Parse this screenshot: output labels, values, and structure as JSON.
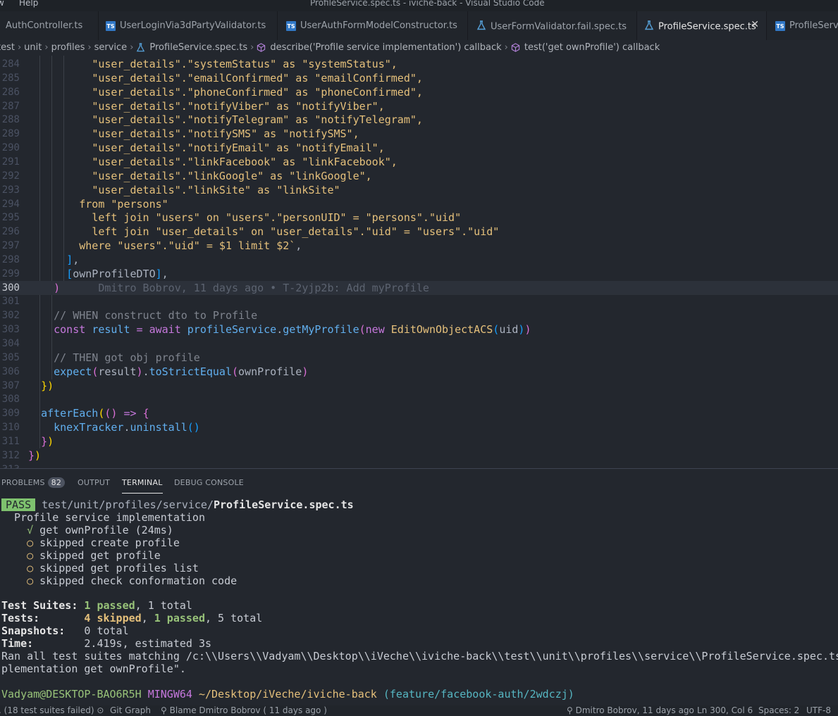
{
  "titlebar": {
    "menu_view": "w",
    "menu_help": "Help",
    "title": "ProfileService.spec.ts - iviche-back - Visual Studio Code"
  },
  "tabs": [
    {
      "label": "AuthController.ts",
      "type": "plain"
    },
    {
      "label": "UserLoginVia3dPartyValidator.ts",
      "type": "ts"
    },
    {
      "label": "UserAuthFormModelConstructor.ts",
      "type": "ts"
    },
    {
      "label": "UserFormValidator.fail.spec.ts",
      "type": "test"
    },
    {
      "label": "ProfileService.spec.ts",
      "type": "test",
      "active": true
    },
    {
      "label": "ProfileServ",
      "type": "ts"
    }
  ],
  "breadcrumb": {
    "items": [
      "test",
      "unit",
      "profiles",
      "service",
      "ProfileService.spec.ts",
      "describe('Profile service implementation') callback",
      "test('get ownProfile') callback"
    ]
  },
  "editor": {
    "lines": [
      {
        "n": "284",
        "html": "          <span class='s'>\"user_details\".\"systemStatus\" as \"systemStatus\",</span>"
      },
      {
        "n": "285",
        "html": "          <span class='s'>\"user_details\".\"emailConfirmed\" as \"emailConfirmed\",</span>"
      },
      {
        "n": "286",
        "html": "          <span class='s'>\"user_details\".\"phoneConfirmed\" as \"phoneConfirmed\",</span>"
      },
      {
        "n": "287",
        "html": "          <span class='s'>\"user_details\".\"notifyViber\" as \"notifyViber\",</span>"
      },
      {
        "n": "288",
        "html": "          <span class='s'>\"user_details\".\"notifyTelegram\" as \"notifyTelegram\",</span>"
      },
      {
        "n": "289",
        "html": "          <span class='s'>\"user_details\".\"notifySMS\" as \"notifySMS\",</span>"
      },
      {
        "n": "290",
        "html": "          <span class='s'>\"user_details\".\"notifyEmail\" as \"notifyEmail\",</span>"
      },
      {
        "n": "291",
        "html": "          <span class='s'>\"user_details\".\"linkFacebook\" as \"linkFacebook\",</span>"
      },
      {
        "n": "292",
        "html": "          <span class='s'>\"user_details\".\"linkGoogle\" as \"linkGoogle\",</span>"
      },
      {
        "n": "293",
        "html": "          <span class='s'>\"user_details\".\"linkSite\" as \"linkSite\"</span>"
      },
      {
        "n": "294",
        "html": "        <span class='s'>from \"persons\"</span>"
      },
      {
        "n": "295",
        "html": "          <span class='s'>left join \"users\" on \"users\".\"personUID\" = \"persons\".\"uid\"</span>"
      },
      {
        "n": "296",
        "html": "          <span class='s'>left join \"user_details\" on \"user_details\".\"uid\" = \"users\".\"uid\"</span>"
      },
      {
        "n": "297",
        "html": "        <span class='s'>where \"users\".\"uid\" = $1 limit $2`</span><span class='p'>,</span>"
      },
      {
        "n": "298",
        "html": "      <span class='br3'>]</span><span class='p'>,</span>"
      },
      {
        "n": "299",
        "html": "      <span class='br3'>[</span><span class='p'>ownProfileDTO</span><span class='br3'>]</span><span class='p'>,</span>"
      },
      {
        "n": "300",
        "html": "    <span class='br2'>)</span>      <span class='blame'>Dmitro Bobrov, 11 days ago • T-2yjp2b: Add myProfile</span>",
        "current": true
      },
      {
        "n": "301",
        "html": ""
      },
      {
        "n": "302",
        "html": "    <span class='cmt'>// WHEN construct dto to Profile</span>"
      },
      {
        "n": "303",
        "html": "    <span class='k'>const</span> <span class='f'>result</span> <span class='k'>=</span> <span class='k'>await</span> <span class='f'>profileService</span><span class='p'>.</span><span class='f'>getMyProfile</span><span class='br2'>(</span><span class='k'>new</span> <span class='t'>EditOwnObjectACS</span><span class='br3'>(</span><span class='p'>uid</span><span class='br3'>)</span><span class='br2'>)</span>"
      },
      {
        "n": "304",
        "html": ""
      },
      {
        "n": "305",
        "html": "    <span class='cmt'>// THEN got obj profile</span>"
      },
      {
        "n": "306",
        "html": "    <span class='f'>expect</span><span class='br2'>(</span><span class='p'>result</span><span class='br2'>)</span><span class='p'>.</span><span class='f'>toStrictEqual</span><span class='br2'>(</span><span class='p'>ownProfile</span><span class='br2'>)</span>"
      },
      {
        "n": "307",
        "html": "  <span class='br1'>})</span>"
      },
      {
        "n": "308",
        "html": ""
      },
      {
        "n": "309",
        "html": "  <span class='f'>afterEach</span><span class='br1'>(</span><span class='br2'>()</span> <span class='k'>=></span> <span class='br2'>{</span>"
      },
      {
        "n": "310",
        "html": "    <span class='f'>knexTracker</span><span class='p'>.</span><span class='f'>uninstall</span><span class='br3'>()</span>"
      },
      {
        "n": "311",
        "html": "  <span class='br2'>}</span><span class='br1'>)</span>"
      },
      {
        "n": "312",
        "html": "<span class='br2'>}</span><span class='br1'>)</span>"
      },
      {
        "n": "313",
        "html": ""
      }
    ]
  },
  "panel": {
    "tabs": {
      "problems": "PROBLEMS",
      "problems_count": "82",
      "output": "OUTPUT",
      "terminal": "TERMINAL",
      "debug": "DEBUG CONSOLE"
    },
    "terminal": {
      "pass_label": "PASS",
      "path_dim": "test/unit/profiles/service/",
      "path_file": "ProfileService.spec.ts",
      "suite": "  Profile service implementation",
      "tests": [
        {
          "mark": "√",
          "name": "get ownProfile (24ms)",
          "status": "pass"
        },
        {
          "mark": "○",
          "name": "skipped create profile",
          "status": "skip"
        },
        {
          "mark": "○",
          "name": "skipped get profile",
          "status": "skip"
        },
        {
          "mark": "○",
          "name": "skipped get profiles list",
          "status": "skip"
        },
        {
          "mark": "○",
          "name": "skipped check conformation code",
          "status": "skip"
        }
      ],
      "summary": {
        "suites_label": "Test Suites:",
        "suites_passed": "1 passed",
        "suites_total": ", 1 total",
        "tests_label": "Tests:",
        "tests_skipped": "4 skipped",
        "tests_passed": "1 passed",
        "tests_total": ", 5 total",
        "snap_label": "Snapshots:",
        "snap_value": "0 total",
        "time_label": "Time:",
        "time_value": "2.419s, estimated 3s"
      },
      "ran_line1": "Ran all test suites matching /c:\\\\Users\\\\Vadyam\\\\Desktop\\\\iVeche\\\\iviche-back\\\\test\\\\unit\\\\profiles\\\\service\\\\ProfileService.spec.ts/i with tests matching \"Profile service im",
      "ran_line2": "plementation get ownProfile\".",
      "prompt": {
        "user": "Vadyam@DESKTOP-BAO6R5H",
        "shell": "MINGW64",
        "path": "~/Desktop/iVeche/iviche-back",
        "branch": "(feature/facebook-auth/2wdczj)"
      }
    }
  },
  "statusbar": {
    "left1": "(18 test suites failed)",
    "git_graph": "Git Graph",
    "blame": "Blame Dmitro Bobrov ( 11 days ago )",
    "author": "Dmitro Bobrov, 11 days ago",
    "position": "Ln 300, Col 6",
    "spaces": "Spaces: 2",
    "encoding": "UTF-8"
  }
}
